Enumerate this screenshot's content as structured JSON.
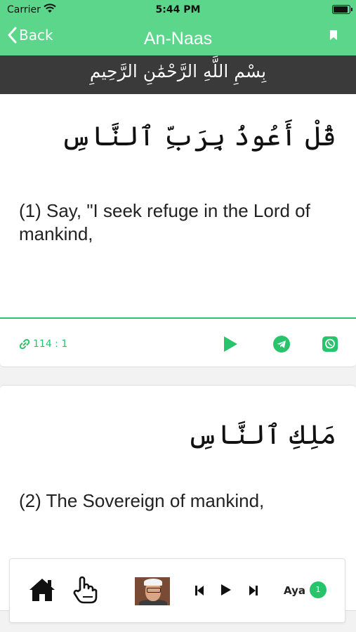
{
  "status_bar": {
    "carrier": "Carrier",
    "time": "5:44 PM"
  },
  "nav": {
    "back_label": "Back",
    "title": "An-Naas"
  },
  "bismillah": "بِسْمِ اللَّهِ الرَّحْمَٰنِ الرَّحِيمِ",
  "verses": [
    {
      "arabic": "قُلْ أَعُوذُ بِرَبِّ ٱلنَّاسِ",
      "translation": "(1) Say, \"I seek refuge in the Lord of mankind,",
      "reference": "114 : 1"
    },
    {
      "arabic": "مَلِكِ ٱلنَّاسِ",
      "translation": "(2) The Sovereign of mankind,"
    }
  ],
  "player": {
    "aya_label": "Aya",
    "aya_number": "1"
  },
  "colors": {
    "accent": "#27c46b",
    "header": "#5cd68a",
    "bismillah_bar": "#3a3a3a"
  },
  "icons": [
    "wifi-icon",
    "battery-icon",
    "chevron-left-icon",
    "bookmark-icon",
    "link-icon",
    "play-icon",
    "telegram-icon",
    "whatsapp-icon",
    "home-icon",
    "hand-pointer-icon",
    "reciter-avatar",
    "skip-previous-icon",
    "skip-next-icon"
  ]
}
